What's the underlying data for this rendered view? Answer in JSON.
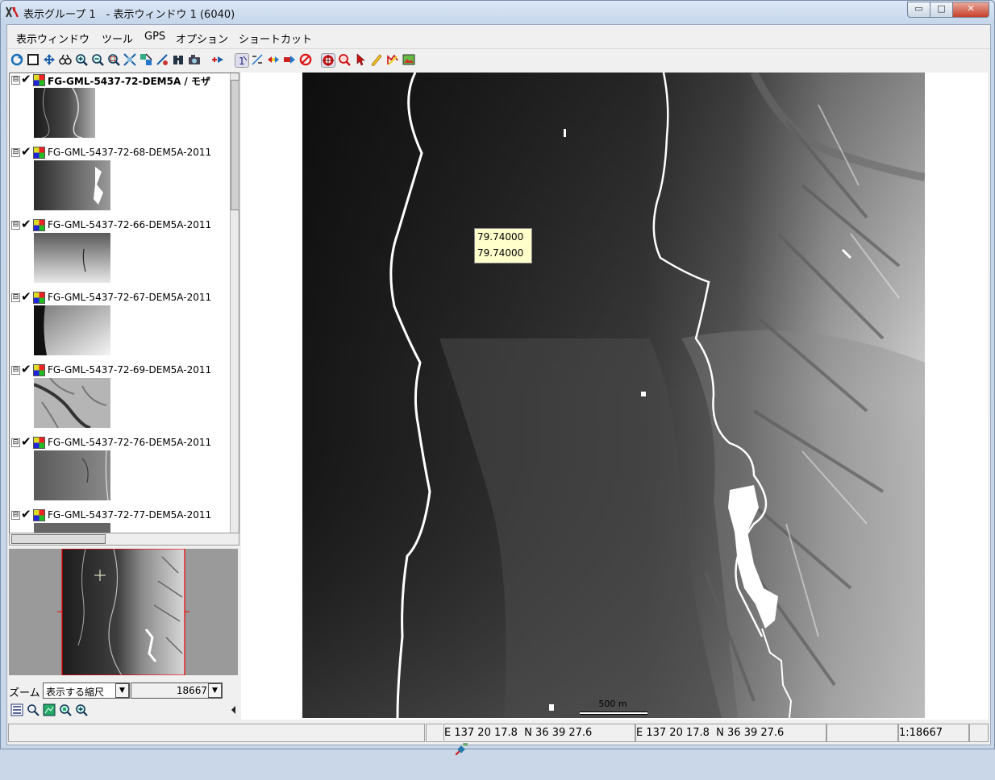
{
  "window": {
    "title": "表示グループ 1　- 表示ウィンドウ 1 (6040)",
    "buttons": {
      "minimize": "▭",
      "maximize": "□",
      "close": "✕"
    }
  },
  "menu": [
    "表示ウィンドウ",
    "ツール",
    "GPS",
    "オプション",
    "ショートカット"
  ],
  "toolbar_icons": [
    "redraw-icon",
    "full-extent-icon",
    "pan-icon",
    "binoculars-icon",
    "zoom-in-icon",
    "zoom-out-icon",
    "zoom-box-icon",
    "zoom-layer-icon",
    "zoom-selected-icon",
    "zoom-previous-icon",
    "find-icon",
    "camera-icon",
    "add-layer-icon",
    "select-one-icon",
    "measure-icon",
    "previous-next-icon",
    "forward-icon",
    "stop-icon",
    "target-icon",
    "inspect-icon",
    "pointer-icon",
    "sketch-icon",
    "edit-icon",
    "picture-icon"
  ],
  "layers": [
    {
      "name": "FG-GML-5437-72-DEM5A / モザ",
      "bold": true,
      "expander": "⊟",
      "check": "✔"
    },
    {
      "name": "FG-GML-5437-72-68-DEM5A-2011",
      "bold": false,
      "expander": "⊟",
      "check": "✔"
    },
    {
      "name": "FG-GML-5437-72-66-DEM5A-2011",
      "bold": false,
      "expander": "⊟",
      "check": "✔"
    },
    {
      "name": "FG-GML-5437-72-67-DEM5A-2011",
      "bold": false,
      "expander": "⊟",
      "check": "✔"
    },
    {
      "name": "FG-GML-5437-72-69-DEM5A-2011",
      "bold": false,
      "expander": "⊟",
      "check": "✔"
    },
    {
      "name": "FG-GML-5437-72-76-DEM5A-2011",
      "bold": false,
      "expander": "⊟",
      "check": "✔"
    },
    {
      "name": "FG-GML-5437-72-77-DEM5A-2011",
      "bold": false,
      "expander": "⊟",
      "check": "✔"
    }
  ],
  "zoom": {
    "label": "ズーム",
    "mode_selected": "表示する縮尺",
    "scale_value": "18667"
  },
  "map": {
    "tooltip_line1": "79.74000",
    "tooltip_line2": "79.74000",
    "scalebar_label": "500 m"
  },
  "status": {
    "coord1": "E 137 20 17.8  N 36 39 27.6",
    "coord2": "E 137 20 17.8  N 36 39 27.6",
    "scale": "1:18667"
  }
}
